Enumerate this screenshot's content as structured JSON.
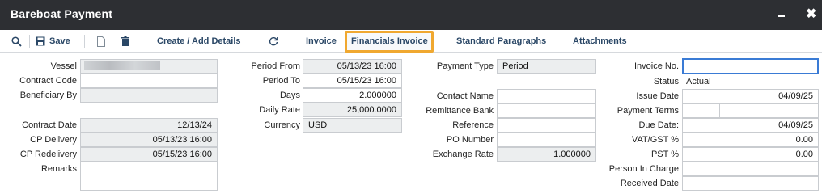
{
  "window": {
    "title": "Bareboat Payment"
  },
  "toolbar": {
    "save_label": "Save",
    "create_add_details_label": "Create / Add Details",
    "tabs": [
      {
        "label": "Invoice",
        "active": false
      },
      {
        "label": "Financials Invoice",
        "active": true
      },
      {
        "label": "Standard Paragraphs",
        "active": false
      },
      {
        "label": "Attachments",
        "active": false
      }
    ]
  },
  "form": {
    "left": {
      "vessel_label": "Vessel",
      "contract_code_label": "Contract Code",
      "contract_code_value": "",
      "beneficiary_by_label": "Beneficiary By",
      "beneficiary_by_value": "",
      "contract_date_label": "Contract Date",
      "contract_date_value": "12/13/24",
      "cp_delivery_label": "CP Delivery",
      "cp_delivery_value": "05/13/23 16:00",
      "cp_redelivery_label": "CP Redelivery",
      "cp_redelivery_value": "05/15/23 16:00",
      "remarks_label": "Remarks",
      "remarks_value": ""
    },
    "period": {
      "period_from_label": "Period From",
      "period_from_value": "05/13/23 16:00",
      "period_to_label": "Period To",
      "period_to_value": "05/15/23 16:00",
      "days_label": "Days",
      "days_value": "2.000000",
      "daily_rate_label": "Daily Rate",
      "daily_rate_value": "25,000.0000",
      "currency_label": "Currency",
      "currency_value": "USD"
    },
    "payment": {
      "payment_type_label": "Payment Type",
      "payment_type_value": "Period",
      "contact_name_label": "Contact Name",
      "contact_name_value": "",
      "remittance_bank_label": "Remittance Bank",
      "remittance_bank_value": "",
      "reference_label": "Reference",
      "reference_value": "",
      "po_number_label": "PO Number",
      "po_number_value": "",
      "exchange_rate_label": "Exchange Rate",
      "exchange_rate_value": "1.000000"
    },
    "invoice": {
      "invoice_no_label": "Invoice No.",
      "invoice_no_value": "",
      "status_label": "Status",
      "status_value": "Actual",
      "issue_date_label": "Issue Date",
      "issue_date_value": "04/09/25",
      "payment_terms_label": "Payment Terms",
      "payment_terms_value": "",
      "due_date_label": "Due Date:",
      "due_date_value": "04/09/25",
      "vat_gst_label": "VAT/GST %",
      "vat_gst_value": "0.00",
      "pst_label": "PST %",
      "pst_value": "0.00",
      "person_in_charge_label": "Person In Charge",
      "person_in_charge_value": "",
      "received_date_label": "Received Date",
      "received_date_value": ""
    }
  }
}
